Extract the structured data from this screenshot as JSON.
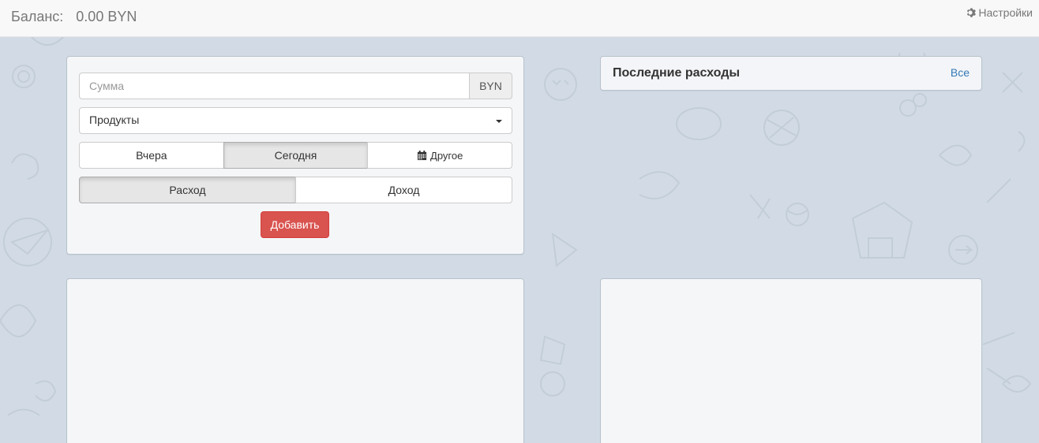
{
  "header": {
    "balance_label": "Баланс:",
    "balance_value": "0.00 BYN",
    "settings_label": "Настройки"
  },
  "form": {
    "amount_placeholder": "Сумма",
    "amount_value": "",
    "currency": "BYN",
    "category_selected": "Продукты",
    "day_buttons": [
      "Вчера",
      "Сегодня",
      "Другое"
    ],
    "day_active": "Сегодня",
    "type_buttons": [
      "Расход",
      "Доход"
    ],
    "type_active": "Расход",
    "add_label": "Добавить"
  },
  "recent": {
    "title": "Последние расходы",
    "all_link": "Все"
  },
  "colors": {
    "accent_danger": "#d9534f",
    "link": "#337ab7",
    "background": "#d2dbe5"
  },
  "icons": {
    "settings": "gear-icon",
    "calendar": "calendar-icon",
    "dropdown": "caret-down-icon"
  }
}
